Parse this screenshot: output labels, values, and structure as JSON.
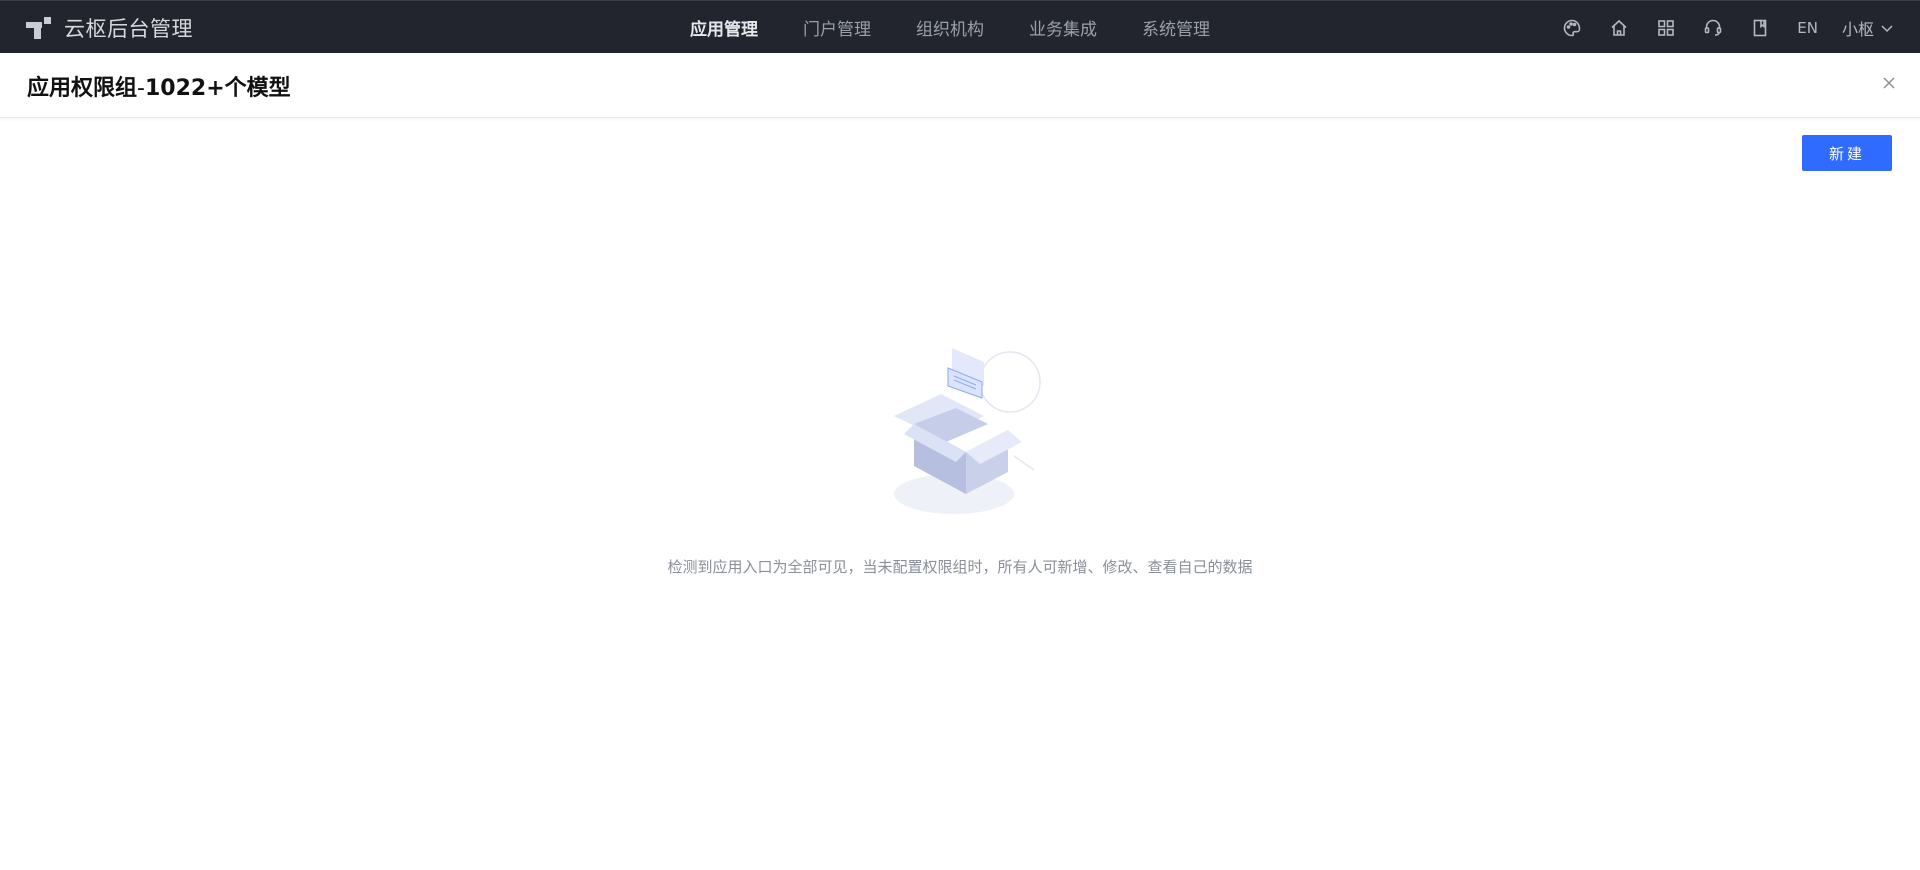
{
  "brand": {
    "name": "云枢后台管理",
    "logo_icon": "cloudpivot-logo-icon"
  },
  "nav": {
    "items": [
      {
        "label": "应用管理",
        "active": true
      },
      {
        "label": "门户管理",
        "active": false
      },
      {
        "label": "组织机构",
        "active": false
      },
      {
        "label": "业务集成",
        "active": false
      },
      {
        "label": "系统管理",
        "active": false
      }
    ]
  },
  "tools": {
    "icons": [
      "palette-icon",
      "home-icon",
      "apps-grid-icon",
      "headset-icon",
      "book-icon"
    ],
    "language": "EN",
    "user_name": "小枢"
  },
  "title_bar": {
    "title_prefix": "应用权限组",
    "title_sep": "-",
    "title_model": "1022+个模型"
  },
  "toolbar": {
    "new_label": "新建"
  },
  "empty": {
    "message": "检测到应用入口为全部可见，当未配置权限组时，所有人可新增、修改、查看自己的数据"
  },
  "colors": {
    "topbar": "#22252d",
    "primary": "#2f6bff"
  }
}
